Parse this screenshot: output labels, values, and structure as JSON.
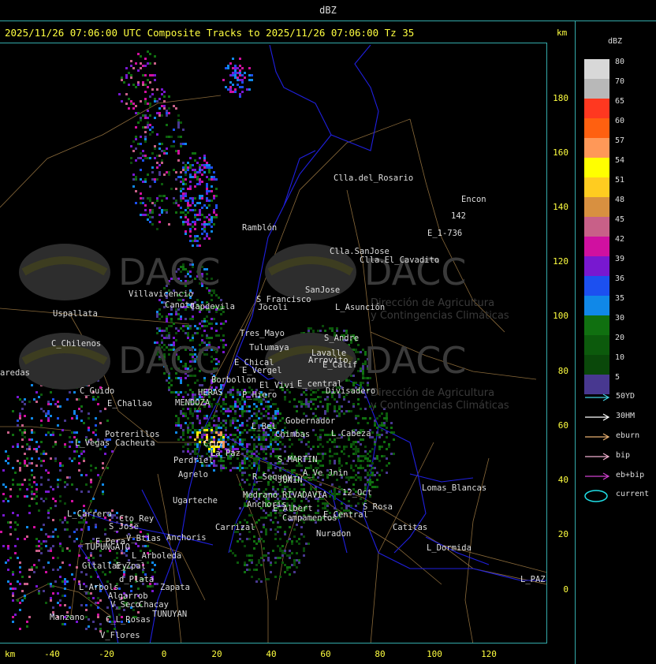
{
  "header": {
    "title": "dBZ"
  },
  "subtitle": "2025/11/26 07:06:00 UTC Composite Tracks to 2025/11/26 07:06:00 Tz 35",
  "axes": {
    "unit": "km",
    "x_ticks": [
      "-40",
      "-20",
      "0",
      "20",
      "40",
      "60",
      "80",
      "100",
      "120"
    ],
    "y_ticks": [
      "180",
      "160",
      "140",
      "120",
      "100",
      "80",
      "60",
      "40",
      "20",
      "0"
    ]
  },
  "legend": {
    "title": "dBZ",
    "levels": [
      {
        "label": "80",
        "color": "#d8d8d8"
      },
      {
        "label": "70",
        "color": "#b8b8b8"
      },
      {
        "label": "65",
        "color": "#ff3820"
      },
      {
        "label": "60",
        "color": "#ff6010"
      },
      {
        "label": "57",
        "color": "#ff9858"
      },
      {
        "label": "54",
        "color": "#ffff00"
      },
      {
        "label": "51",
        "color": "#ffcc20"
      },
      {
        "label": "48",
        "color": "#d89040"
      },
      {
        "label": "45",
        "color": "#c86088"
      },
      {
        "label": "42",
        "color": "#d010a0"
      },
      {
        "label": "39",
        "color": "#7818d0"
      },
      {
        "label": "36",
        "color": "#1c50f0"
      },
      {
        "label": "35",
        "color": "#1088e8"
      },
      {
        "label": "30",
        "color": "#107010"
      },
      {
        "label": "20",
        "color": "#0c5a0c"
      },
      {
        "label": "10",
        "color": "#0a480a"
      },
      {
        "label": "5",
        "color": "#483890"
      }
    ],
    "tracks": [
      {
        "label": "50YD",
        "color": "#40d0e0"
      },
      {
        "label": "30HM",
        "color": "#ffffff"
      },
      {
        "label": "eburn",
        "color": "#e8b070"
      },
      {
        "label": "bip",
        "color": "#f0b0d0"
      },
      {
        "label": "eb+bip",
        "color": "#d040d0"
      }
    ],
    "current_label": "current",
    "current_color": "#20e0e8"
  },
  "watermark": {
    "brand": "DACC",
    "line1": "Dirección de Agricultura",
    "line2": "y Contingencias Climáticas"
  },
  "places": [
    {
      "label": "Clla.del_Rosario",
      "x": 423,
      "y": 220
    },
    {
      "label": "Encon",
      "x": 585,
      "y": 247
    },
    {
      "label": "142",
      "x": 572,
      "y": 268
    },
    {
      "label": "E_1-736",
      "x": 542,
      "y": 290
    },
    {
      "label": "Ramblón",
      "x": 307,
      "y": 283
    },
    {
      "label": "Clla.SanJose",
      "x": 418,
      "y": 313
    },
    {
      "label": "Clla.El_Cavadito",
      "x": 456,
      "y": 324
    },
    {
      "label": "SanJose",
      "x": 387,
      "y": 362
    },
    {
      "label": "S_Francisco",
      "x": 325,
      "y": 374
    },
    {
      "label": "Jocoli",
      "x": 327,
      "y": 384
    },
    {
      "label": "L_Asunción",
      "x": 425,
      "y": 384
    },
    {
      "label": "Villavicencio",
      "x": 163,
      "y": 367
    },
    {
      "label": "Canota",
      "x": 209,
      "y": 381
    },
    {
      "label": "Capdevila",
      "x": 241,
      "y": 383
    },
    {
      "label": "Uspallata",
      "x": 67,
      "y": 392
    },
    {
      "label": "Tres_Mayo",
      "x": 304,
      "y": 417
    },
    {
      "label": "S_Andre",
      "x": 411,
      "y": 423
    },
    {
      "label": "Tulumaya",
      "x": 316,
      "y": 435
    },
    {
      "label": "Lavalle",
      "x": 395,
      "y": 442
    },
    {
      "label": "C_Chilenos",
      "x": 65,
      "y": 430
    },
    {
      "label": "E_Chical",
      "x": 297,
      "y": 454
    },
    {
      "label": "Arrovito",
      "x": 391,
      "y": 451
    },
    {
      "label": "E_Calif",
      "x": 409,
      "y": 457
    },
    {
      "label": "E_Vergel",
      "x": 307,
      "y": 464
    },
    {
      "label": "aredas",
      "x": 0,
      "y": 467
    },
    {
      "label": "Borbollon",
      "x": 268,
      "y": 476
    },
    {
      "label": "El_Vivi",
      "x": 329,
      "y": 483
    },
    {
      "label": "E_central",
      "x": 377,
      "y": 481
    },
    {
      "label": "Divisadero",
      "x": 413,
      "y": 490
    },
    {
      "label": "C_Guido",
      "x": 101,
      "y": 490
    },
    {
      "label": "HERAS",
      "x": 251,
      "y": 492
    },
    {
      "label": "P_Hiero",
      "x": 307,
      "y": 495
    },
    {
      "label": "E_Challao",
      "x": 136,
      "y": 506
    },
    {
      "label": "MENDOZA",
      "x": 222,
      "y": 505
    },
    {
      "label": "Gobernador",
      "x": 362,
      "y": 528
    },
    {
      "label": "L_Bel",
      "x": 319,
      "y": 535
    },
    {
      "label": "Chimbas",
      "x": 349,
      "y": 545
    },
    {
      "label": "L_Cabeza",
      "x": 420,
      "y": 544
    },
    {
      "label": "Potrerillos",
      "x": 133,
      "y": 545
    },
    {
      "label": "L_Vegas",
      "x": 95,
      "y": 556
    },
    {
      "label": "Cacheuta",
      "x": 146,
      "y": 556
    },
    {
      "label": "Cruz",
      "x": 258,
      "y": 557
    },
    {
      "label": "La_Paz",
      "x": 267,
      "y": 569
    },
    {
      "label": "Perdriel",
      "x": 220,
      "y": 578
    },
    {
      "label": "S_MARTIN",
      "x": 352,
      "y": 577
    },
    {
      "label": "A_Ve",
      "x": 384,
      "y": 594
    },
    {
      "label": "Jnin",
      "x": 416,
      "y": 594
    },
    {
      "label": "Agrelo",
      "x": 226,
      "y": 596
    },
    {
      "label": "R_Sequey",
      "x": 320,
      "y": 599
    },
    {
      "label": "JUNIN",
      "x": 352,
      "y": 603
    },
    {
      "label": "Lomas_Blancas",
      "x": 535,
      "y": 613
    },
    {
      "label": "Medrano",
      "x": 308,
      "y": 622
    },
    {
      "label": "RIVADAVIA",
      "x": 358,
      "y": 622
    },
    {
      "label": "12_Oct",
      "x": 434,
      "y": 619
    },
    {
      "label": "Ugarteche",
      "x": 219,
      "y": 629
    },
    {
      "label": "Anchoris",
      "x": 313,
      "y": 634
    },
    {
      "label": "S_Rosa",
      "x": 460,
      "y": 637
    },
    {
      "label": "L_Carrera",
      "x": 85,
      "y": 646
    },
    {
      "label": "Cto_Rey",
      "x": 151,
      "y": 652
    },
    {
      "label": "E_Albert",
      "x": 346,
      "y": 639
    },
    {
      "label": "E_Central",
      "x": 410,
      "y": 647
    },
    {
      "label": "Campamentos",
      "x": 358,
      "y": 651
    },
    {
      "label": "S_Jose",
      "x": 138,
      "y": 662
    },
    {
      "label": "Catitas",
      "x": 498,
      "y": 663
    },
    {
      "label": "Carrizal",
      "x": 273,
      "y": 663
    },
    {
      "label": "Nuradon",
      "x": 401,
      "y": 671
    },
    {
      "label": "V_Btias",
      "x": 160,
      "y": 677
    },
    {
      "label": "Anchoris",
      "x": 211,
      "y": 676
    },
    {
      "label": "E_Pera",
      "x": 121,
      "y": 681
    },
    {
      "label": "TUPUNGATO",
      "x": 108,
      "y": 688
    },
    {
      "label": "L_Dormida",
      "x": 541,
      "y": 689
    },
    {
      "label": "L_Arboleda",
      "x": 167,
      "y": 699
    },
    {
      "label": "Gltallary",
      "x": 104,
      "y": 712
    },
    {
      "label": "E_Zpal",
      "x": 147,
      "y": 712
    },
    {
      "label": "d_Plata",
      "x": 151,
      "y": 729
    },
    {
      "label": "L_Arbols",
      "x": 100,
      "y": 739
    },
    {
      "label": "Zapata",
      "x": 203,
      "y": 739
    },
    {
      "label": "L_PAZ",
      "x": 660,
      "y": 729
    },
    {
      "label": "Algarrob",
      "x": 137,
      "y": 750
    },
    {
      "label": "V_Seco",
      "x": 140,
      "y": 761
    },
    {
      "label": "Chacay",
      "x": 176,
      "y": 761
    },
    {
      "label": "TUNUYAN",
      "x": 193,
      "y": 773
    },
    {
      "label": "Manzano",
      "x": 63,
      "y": 777
    },
    {
      "label": "C_L_Rosas",
      "x": 134,
      "y": 780
    },
    {
      "label": "V_Flores",
      "x": 127,
      "y": 800
    }
  ]
}
